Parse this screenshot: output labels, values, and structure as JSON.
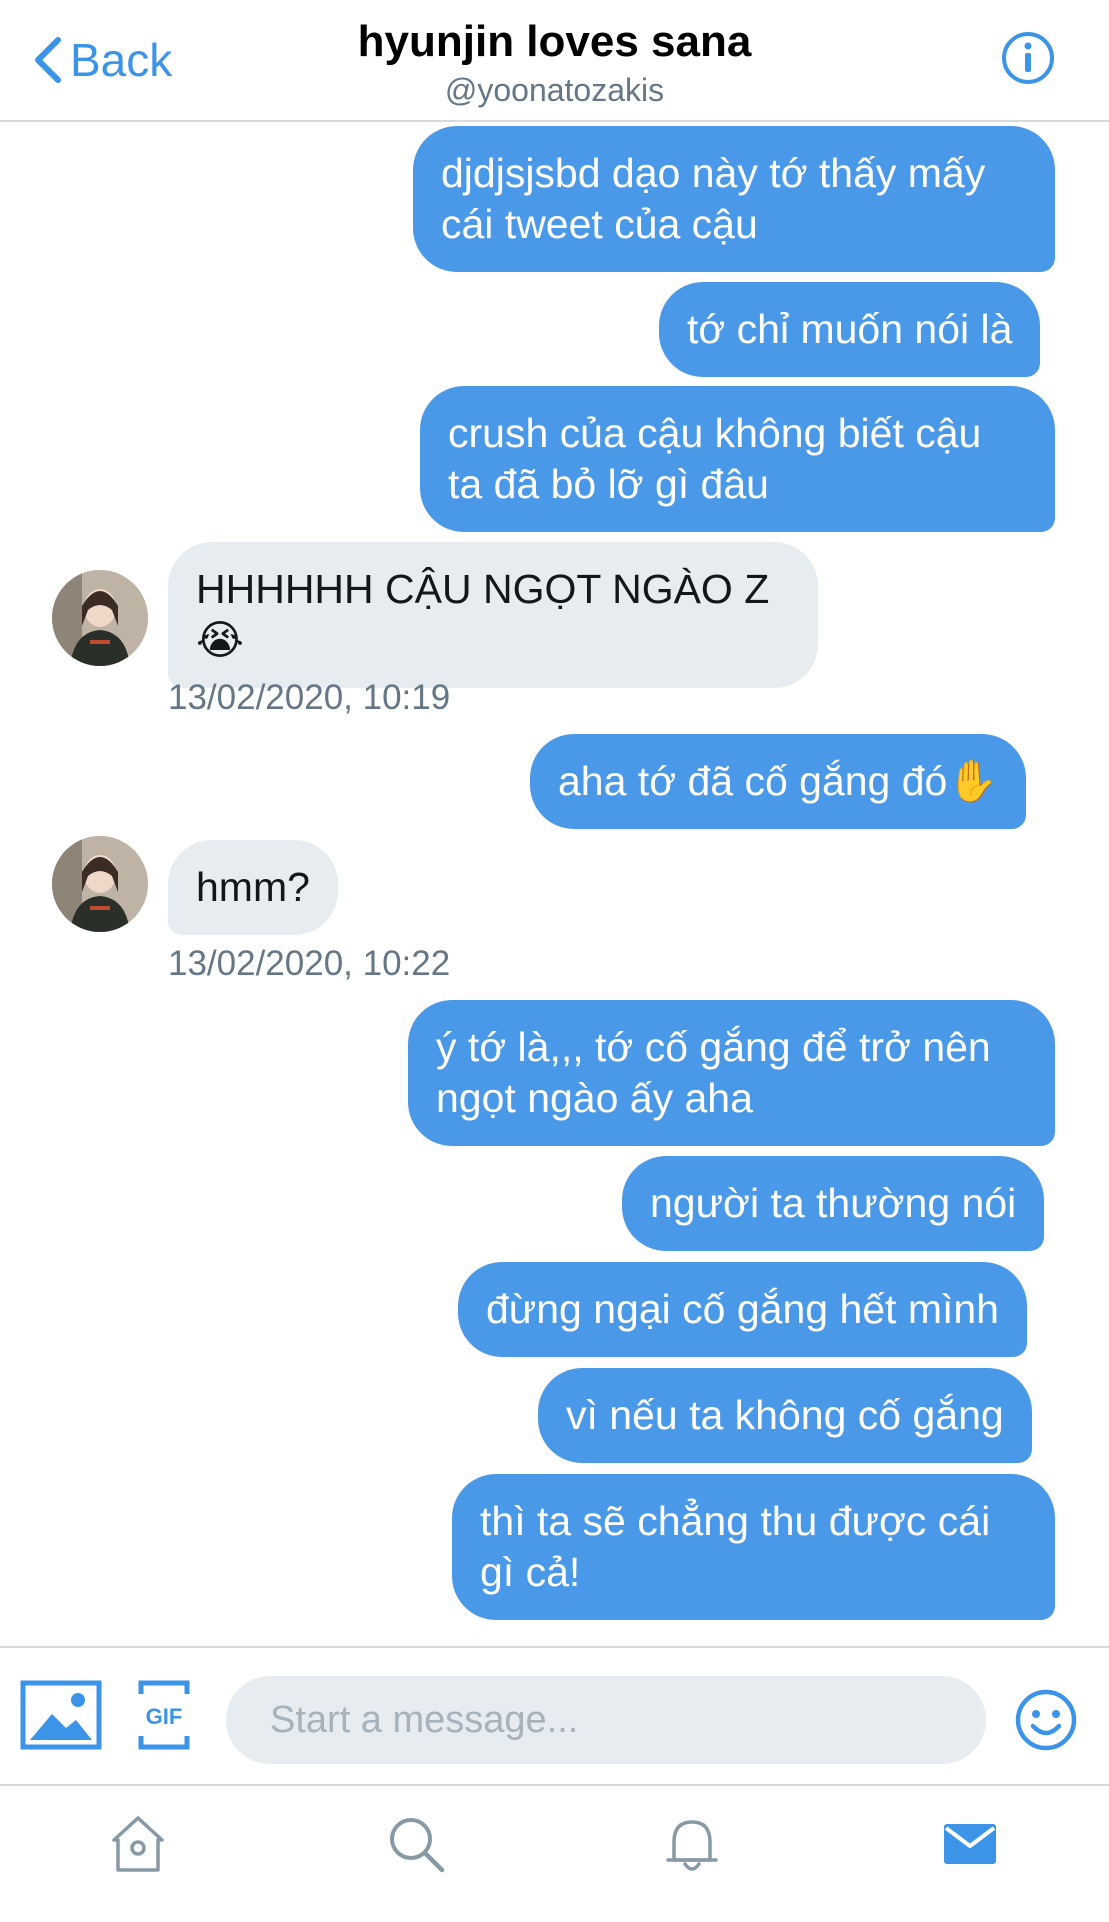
{
  "header": {
    "back_label": "Back",
    "title": "hyunjin loves sana",
    "handle": "@yoonatozakis"
  },
  "messages": [
    {
      "from": "me",
      "text": "djdjsjsbd dạo này tớ thấy mấy\ncái tweet của cậu"
    },
    {
      "from": "me",
      "text": "tớ chỉ muốn nói là"
    },
    {
      "from": "me",
      "text": "crush của cậu không biết cậu\nta đã bỏ lỡ gì đâu"
    },
    {
      "from": "them",
      "text": "HHHHHH CẬU NGỌT NGÀO Z\n😭",
      "timestamp": "13/02/2020, 10:19"
    },
    {
      "from": "me",
      "text": "aha tớ đã cố gắng đó✋"
    },
    {
      "from": "them",
      "text": "hmm?",
      "timestamp": "13/02/2020, 10:22"
    },
    {
      "from": "me",
      "text": "ý tớ là,,, tớ cố gắng để trở nên\nngọt ngào ấy aha"
    },
    {
      "from": "me",
      "text": "người ta thường nói"
    },
    {
      "from": "me",
      "text": "đừng ngại cố gắng hết mình"
    },
    {
      "from": "me",
      "text": "vì nếu ta không cố gắng"
    },
    {
      "from": "me",
      "text": "thì ta sẽ chẳng thu được cái\ngì cả!"
    }
  ],
  "composer": {
    "placeholder": "Start a message...",
    "gif_label": "GIF"
  },
  "icons": {
    "back": "chevron-left-icon",
    "info": "info-icon",
    "photo": "image-icon",
    "gif": "gif-icon",
    "emoji": "emoji-icon",
    "home": "home-icon",
    "search": "search-icon",
    "notifications": "bell-icon",
    "messages": "mail-icon"
  },
  "colors": {
    "accent": "#3b94e8",
    "outgoing_bubble": "#4a99e9",
    "incoming_bubble": "#e6ecf0",
    "timestamp": "#657786"
  }
}
